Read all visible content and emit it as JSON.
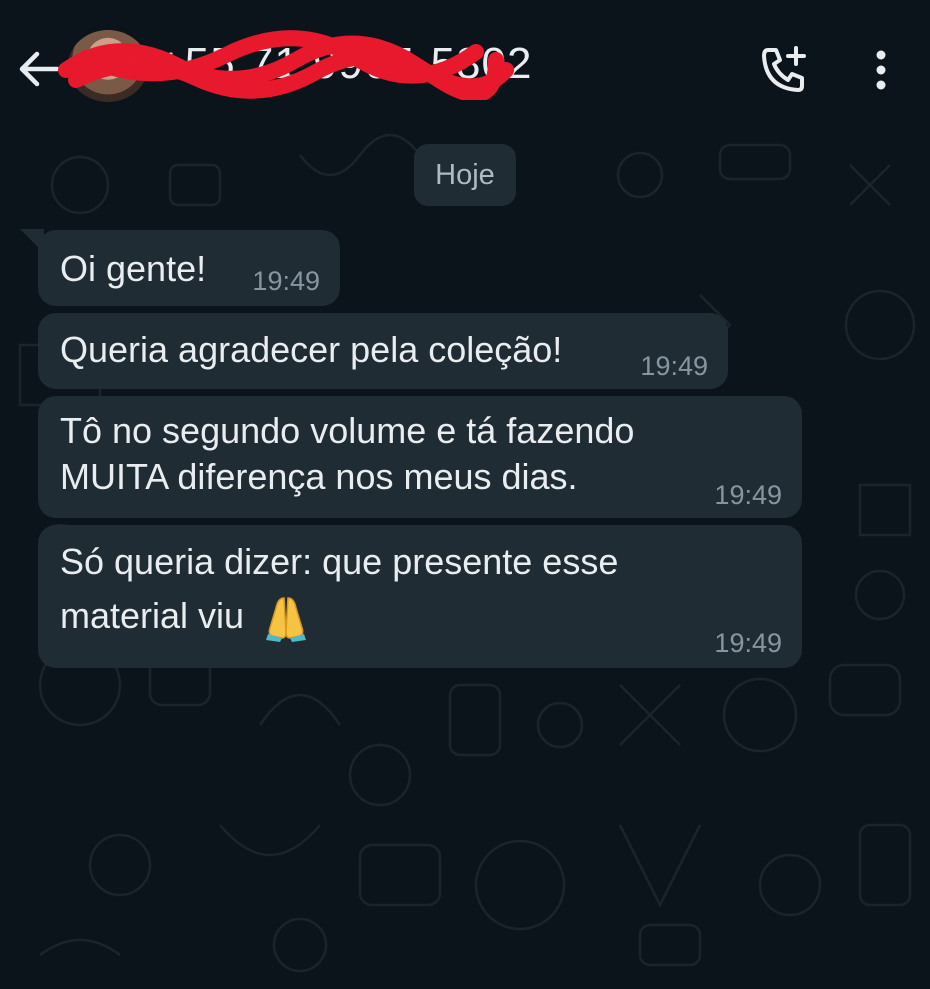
{
  "header": {
    "back_icon": "arrow-left-icon",
    "contact_name": "+55 71 9965-5802",
    "add_call_icon": "phone-plus-icon",
    "menu_icon": "more-vertical-icon"
  },
  "chat": {
    "date_label": "Hoje",
    "messages": [
      {
        "lines": [
          "Oi gente!"
        ],
        "time": "19:49"
      },
      {
        "lines": [
          "Queria agradecer pela coleção!"
        ],
        "time": "19:49"
      },
      {
        "lines": [
          "Tô no segundo volume e tá fazendo",
          "MUITA diferença nos meus dias."
        ],
        "time": "19:49"
      },
      {
        "lines": [
          "Só queria dizer: que presente esse",
          "material viu"
        ],
        "time": "19:49",
        "emoji": "folded-hands-icon"
      }
    ]
  },
  "colors": {
    "background": "#0b141a",
    "bubble": "#202c33",
    "text": "#e9edef",
    "timestamp": "#8696a0",
    "redaction": "#e8192c"
  }
}
